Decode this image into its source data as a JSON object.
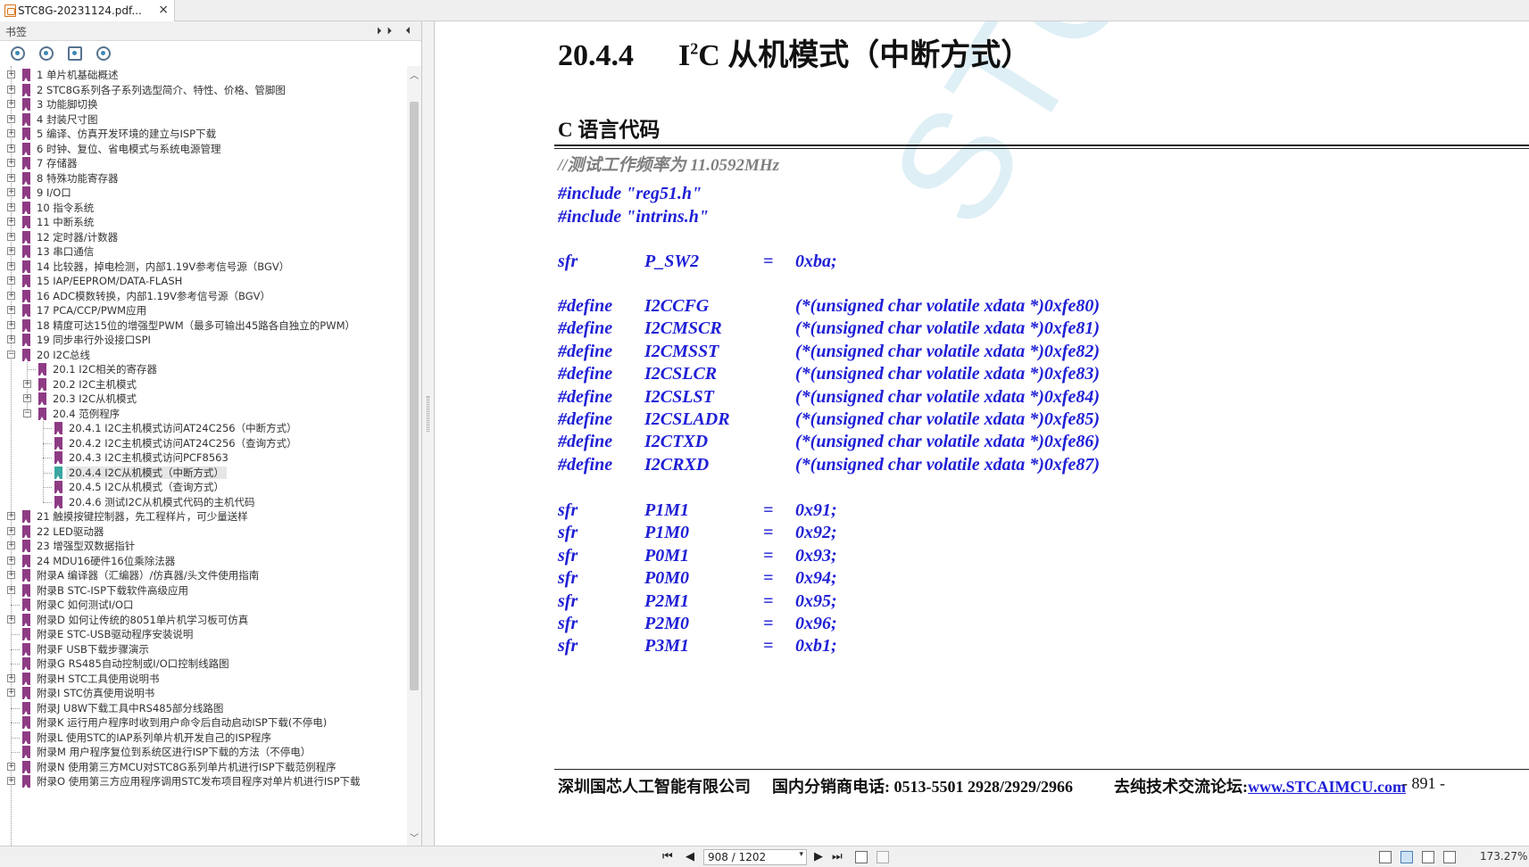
{
  "tab": {
    "title": "STC8G-20231124.pdf...",
    "close": "×"
  },
  "sidebar": {
    "title": "书签",
    "header_buttons": "⏵⏵ ⏴",
    "items": [
      "1 单片机基础概述",
      "2  STC8G系列各子系列选型简介、特性、价格、管脚图",
      "3  功能脚切换",
      "4  封装尺寸图",
      "5  编译、仿真开发环境的建立与ISP下载",
      "6  时钟、复位、省电模式与系统电源管理",
      "7  存储器",
      "8  特殊功能寄存器",
      "9  I/O口",
      "10  指令系统",
      "11  中断系统",
      "12  定时器/计数器",
      "13  串口通信",
      "14  比较器，掉电检测，内部1.19V参考信号源（BGV）",
      "15  IAP/EEPROM/DATA-FLASH",
      "16  ADC模数转换，内部1.19V参考信号源（BGV）",
      "17  PCA/CCP/PWM应用",
      "18  精度可达15位的增强型PWM（最多可输出45路各自独立的PWM）",
      "19  同步串行外设接口SPI",
      "20  I2C总线",
      "20.1 I2C相关的寄存器",
      "20.2  I2C主机模式",
      "20.3  I2C从机模式",
      "20.4  范例程序",
      "20.4.1 I2C主机模式访问AT24C256（中断方式）",
      "20.4.2 I2C主机模式访问AT24C256（查询方式）",
      "20.4.3 I2C主机模式访问PCF8563",
      "20.4.4 I2C从机模式（中断方式）",
      "20.4.5 I2C从机模式（查询方式）",
      "20.4.6 测试I2C从机模式代码的主机代码",
      "21  触摸按键控制器，先工程样片，可少量送样",
      "22  LED驱动器",
      "23  增强型双数据指针",
      "24  MDU16硬件16位乘除法器",
      "附录A  编译器（汇编器）/仿真器/头文件使用指南",
      "附录B  STC-ISP下载软件高级应用",
      "附录C  如何测试I/O口",
      "附录D  如何让传统的8051单片机学习板可仿真",
      "附录E  STC-USB驱动程序安装说明",
      "附录F  USB下载步骤演示",
      "附录G  RS485自动控制或I/O口控制线路图",
      "附录H  STC工具使用说明书",
      "附录I  STC仿真使用说明书",
      "附录J  U8W下载工具中RS485部分线路图",
      "附录K  运行用户程序时收到用户命令后自动启动ISP下载(不停电)",
      "附录L  使用STC的IAP系列单片机开发自己的ISP程序",
      "附录M  用户程序复位到系统区进行ISP下载的方法（不停电）",
      "附录N  使用第三方MCU对STC8G系列单片机进行ISP下载范例程序",
      "附录O  使用第三方应用程序调用STC发布项目程序对单片机进行ISP下载"
    ]
  },
  "page": {
    "watermark": "STC",
    "heading_num": "20.4.4",
    "heading_i": "I",
    "heading_sup": "2",
    "heading_rest": "C 从机模式（中断方式）",
    "subheading": "C 语言代码",
    "comment": "//测试工作频率为 11.0592MHz",
    "includes": [
      "#include \"reg51.h\"",
      "#include \"intrins.h\""
    ],
    "sfr_psw2": [
      "sfr",
      "P_SW2",
      "=",
      "0xba;"
    ],
    "defines": [
      [
        "#define",
        "I2CCFG",
        "(*(unsigned char volatile xdata *)0xfe80)"
      ],
      [
        "#define",
        "I2CMSCR",
        "(*(unsigned char volatile xdata *)0xfe81)"
      ],
      [
        "#define",
        "I2CMSST",
        "(*(unsigned char volatile xdata *)0xfe82)"
      ],
      [
        "#define",
        "I2CSLCR",
        "(*(unsigned char volatile xdata *)0xfe83)"
      ],
      [
        "#define",
        "I2CSLST",
        "(*(unsigned char volatile xdata *)0xfe84)"
      ],
      [
        "#define",
        "I2CSLADR",
        "(*(unsigned char volatile xdata *)0xfe85)"
      ],
      [
        "#define",
        "I2CTXD",
        "(*(unsigned char volatile xdata *)0xfe86)"
      ],
      [
        "#define",
        "I2CRXD",
        "(*(unsigned char volatile xdata *)0xfe87)"
      ]
    ],
    "sfrs": [
      [
        "sfr",
        "P1M1",
        "=",
        "0x91;"
      ],
      [
        "sfr",
        "P1M0",
        "=",
        "0x92;"
      ],
      [
        "sfr",
        "P0M1",
        "=",
        "0x93;"
      ],
      [
        "sfr",
        "P0M0",
        "=",
        "0x94;"
      ],
      [
        "sfr",
        "P2M1",
        "=",
        "0x95;"
      ],
      [
        "sfr",
        "P2M0",
        "=",
        "0x96;"
      ],
      [
        "sfr",
        "P3M1",
        "=",
        "0xb1;"
      ]
    ],
    "footer": {
      "company": "深圳国芯人工智能有限公司",
      "phone": "国内分销商电话: 0513-5501 2928/2929/2966",
      "forum_label": "去纯技术交流论坛:",
      "forum_link": "www.STCAIMCU.com",
      "page_num": "- 891 -"
    }
  },
  "statusbar": {
    "page_indicator": "908 / 1202",
    "zoom": "173.27%"
  }
}
